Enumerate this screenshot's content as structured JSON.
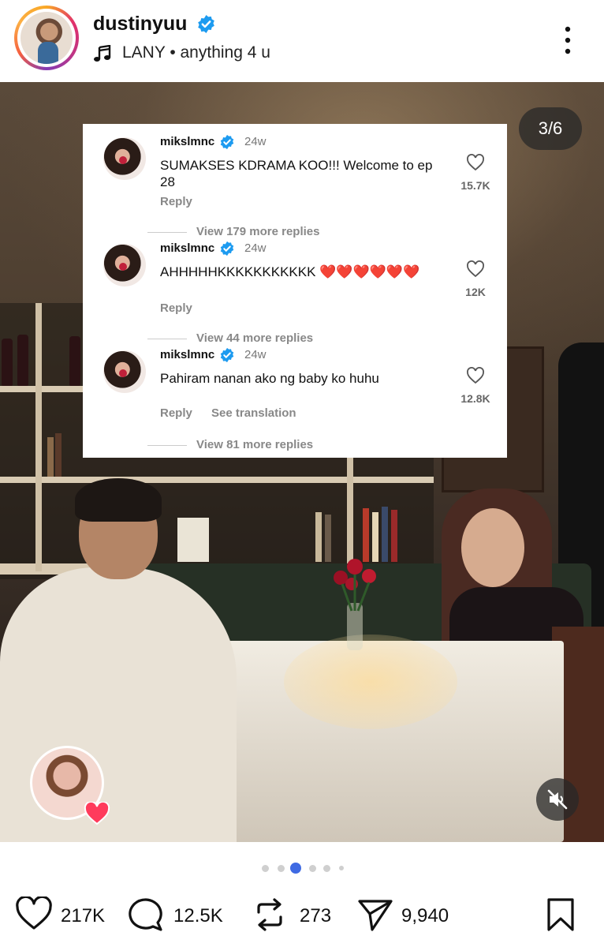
{
  "header": {
    "username": "dustinyuu",
    "music": "LANY • anything 4 u"
  },
  "post": {
    "counter": "3/6",
    "dots_total": 6,
    "dots_active_index": 2
  },
  "comments": [
    {
      "user": "mikslmnc",
      "time": "24w",
      "text": "SUMAKSES KDRAMA KOO!!! Welcome to ep 28",
      "reply": "Reply",
      "translate": "",
      "likes": "15.7K",
      "view_replies": "View 179 more replies"
    },
    {
      "user": "mikslmnc",
      "time": "24w",
      "text": "AHHHHHKKKKKKKKKKK ❤️❤️❤️❤️❤️❤️",
      "reply": "Reply",
      "translate": "",
      "likes": "12K",
      "view_replies": "View 44 more replies"
    },
    {
      "user": "mikslmnc",
      "time": "24w",
      "text": "Pahiram nanan ako ng baby ko huhu",
      "reply": "Reply",
      "translate": "See translation",
      "likes": "12.8K",
      "view_replies": "View 81 more replies"
    }
  ],
  "action_bar": {
    "likes": "217K",
    "comments": "12.5K",
    "reposts": "273",
    "shares": "9,940"
  },
  "colors": {
    "verified": "#1d9bf0",
    "active_dot": "#3f6ae3",
    "heart": "#ff3b5c"
  }
}
